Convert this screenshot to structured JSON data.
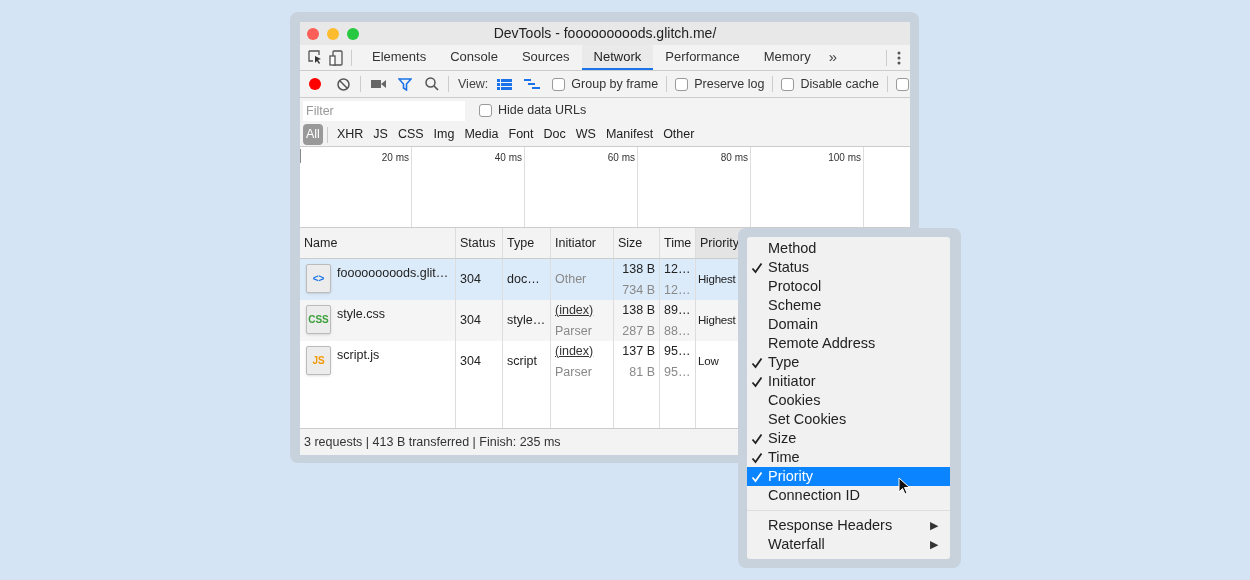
{
  "window": {
    "title": "DevTools - fooooooooods.glitch.me/"
  },
  "tabs": [
    {
      "label": "Elements",
      "selected": false
    },
    {
      "label": "Console",
      "selected": false
    },
    {
      "label": "Sources",
      "selected": false
    },
    {
      "label": "Network",
      "selected": true
    },
    {
      "label": "Performance",
      "selected": false
    },
    {
      "label": "Memory",
      "selected": false
    }
  ],
  "tabs_overflow": "»",
  "toolbar": {
    "recording": true,
    "filter_on": true,
    "view_label": "View:",
    "large_rows": true,
    "checkboxes": [
      {
        "label": "Group by frame",
        "checked": false
      },
      {
        "label": "Preserve log",
        "checked": false
      },
      {
        "label": "Disable cache",
        "checked": false
      }
    ],
    "cut_checkbox": {
      "checked": false
    }
  },
  "filter": {
    "placeholder": "Filter",
    "hide_data_urls": {
      "label": "Hide data URLs",
      "checked": false
    }
  },
  "type_filters": [
    {
      "label": "All",
      "selected": true
    },
    {
      "label": "XHR",
      "selected": false
    },
    {
      "label": "JS",
      "selected": false
    },
    {
      "label": "CSS",
      "selected": false
    },
    {
      "label": "Img",
      "selected": false
    },
    {
      "label": "Media",
      "selected": false
    },
    {
      "label": "Font",
      "selected": false
    },
    {
      "label": "Doc",
      "selected": false
    },
    {
      "label": "WS",
      "selected": false
    },
    {
      "label": "Manifest",
      "selected": false
    },
    {
      "label": "Other",
      "selected": false
    }
  ],
  "timeline": {
    "ticks": [
      "20 ms",
      "40 ms",
      "60 ms",
      "80 ms",
      "100 ms"
    ]
  },
  "table": {
    "columns": [
      "Name",
      "Status",
      "Type",
      "Initiator",
      "Size",
      "Time",
      "Priority"
    ],
    "rows": [
      {
        "selected": true,
        "icon_text": "<>",
        "color": "#1a73e8",
        "name": "fooooooooods.glit…",
        "status": "304",
        "type": "doc…",
        "initiator": {
          "text": "Other",
          "link": false
        },
        "size": [
          "138 B",
          "734 B"
        ],
        "time": [
          "12…",
          "12…"
        ],
        "priority": "Highest"
      },
      {
        "selected": false,
        "icon_text": "CSS",
        "color": "#3aa03a",
        "name": "style.css",
        "status": "304",
        "type": "style…",
        "initiator": {
          "text": "(index)",
          "link": true,
          "detail": "Parser"
        },
        "size": [
          "138 B",
          "287 B"
        ],
        "time": [
          "89…",
          "88…"
        ],
        "priority": "Highest"
      },
      {
        "selected": false,
        "icon_text": "JS",
        "color": "#f29900",
        "name": "script.js",
        "status": "304",
        "type": "script",
        "initiator": {
          "text": "(index)",
          "link": true,
          "detail": "Parser"
        },
        "size": [
          "137 B",
          "81 B"
        ],
        "time": [
          "95…",
          "95…"
        ],
        "priority": "Low"
      }
    ]
  },
  "status_bar": "3 requests | 413 B transferred | Finish: 235 ms",
  "context_menu": {
    "items": [
      {
        "kind": "item",
        "label": "Method",
        "checked": false,
        "selected": false
      },
      {
        "kind": "item",
        "label": "Status",
        "checked": true,
        "selected": false
      },
      {
        "kind": "item",
        "label": "Protocol",
        "checked": false,
        "selected": false
      },
      {
        "kind": "item",
        "label": "Scheme",
        "checked": false,
        "selected": false
      },
      {
        "kind": "item",
        "label": "Domain",
        "checked": false,
        "selected": false
      },
      {
        "kind": "item",
        "label": "Remote Address",
        "checked": false,
        "selected": false
      },
      {
        "kind": "item",
        "label": "Type",
        "checked": true,
        "selected": false
      },
      {
        "kind": "item",
        "label": "Initiator",
        "checked": true,
        "selected": false
      },
      {
        "kind": "item",
        "label": "Cookies",
        "checked": false,
        "selected": false
      },
      {
        "kind": "item",
        "label": "Set Cookies",
        "checked": false,
        "selected": false
      },
      {
        "kind": "item",
        "label": "Size",
        "checked": true,
        "selected": false
      },
      {
        "kind": "item",
        "label": "Time",
        "checked": true,
        "selected": false
      },
      {
        "kind": "item",
        "label": "Priority",
        "checked": true,
        "selected": true
      },
      {
        "kind": "item",
        "label": "Connection ID",
        "checked": false,
        "selected": false
      },
      {
        "kind": "separator"
      },
      {
        "kind": "submenu",
        "label": "Response Headers",
        "arrow": "▶",
        "selected": false
      },
      {
        "kind": "submenu",
        "label": "Waterfall",
        "arrow": "▶",
        "selected": false
      }
    ]
  }
}
